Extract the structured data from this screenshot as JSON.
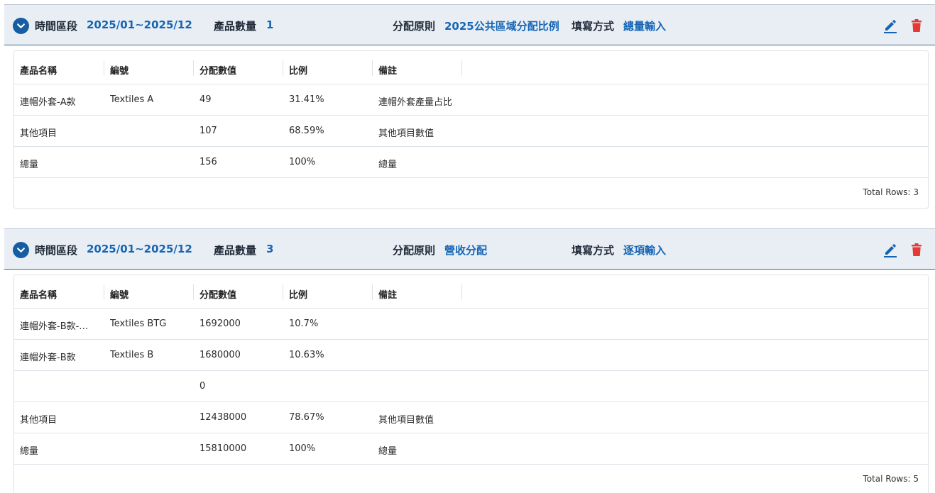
{
  "colors": {
    "accent": "#1565b4",
    "delete": "#e53935",
    "header_bg": "#e9eef4"
  },
  "groups": [
    {
      "time_label": "時間區段",
      "time_value": "2025/01~2025/12",
      "count_label": "產品數量",
      "count_value": "1",
      "rule_label": "分配原則",
      "rule_value": "2025公共區域分配比例",
      "method_label": "填寫方式",
      "method_value": "總量輸入",
      "columns": [
        "產品名稱",
        "編號",
        "分配數值",
        "比例",
        "備註"
      ],
      "rows": [
        [
          "連帽外套-A款",
          "Textiles A",
          "49",
          "31.41%",
          "連帽外套產量占比"
        ],
        [
          "其他項目",
          "",
          "107",
          "68.59%",
          "其他項目數值"
        ],
        [
          "總量",
          "",
          "156",
          "100%",
          "總量"
        ]
      ],
      "total_rows": "Total Rows: 3"
    },
    {
      "time_label": "時間區段",
      "time_value": "2025/01~2025/12",
      "count_label": "產品數量",
      "count_value": "3",
      "rule_label": "分配原則",
      "rule_value": "營收分配",
      "method_label": "填寫方式",
      "method_value": "逐項輸入",
      "columns": [
        "產品名稱",
        "編號",
        "分配數值",
        "比例",
        "備註"
      ],
      "rows": [
        [
          "連帽外套-B款-…",
          "Textiles BTG",
          "1692000",
          "10.7%",
          ""
        ],
        [
          "連帽外套-B款",
          "Textiles B",
          "1680000",
          "10.63%",
          ""
        ],
        [
          "",
          "",
          "0",
          "",
          ""
        ],
        [
          "其他項目",
          "",
          "12438000",
          "78.67%",
          "其他項目數值"
        ],
        [
          "總量",
          "",
          "15810000",
          "100%",
          "總量"
        ]
      ],
      "total_rows": "Total Rows: 5"
    }
  ],
  "icons": {
    "toggle": "chevron-down-icon",
    "edit": "pencil-icon",
    "delete": "trash-icon"
  }
}
